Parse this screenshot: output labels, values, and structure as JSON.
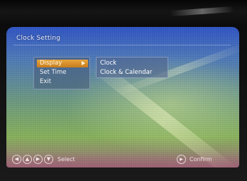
{
  "osd": {
    "title": "Clock Setting"
  },
  "menu": {
    "items": [
      {
        "label": "Display",
        "selected": true
      },
      {
        "label": "Set Time",
        "selected": false
      },
      {
        "label": "Exit",
        "selected": false
      }
    ],
    "selected_color": "#e09a35"
  },
  "submenu": {
    "items": [
      {
        "label": "Clock"
      },
      {
        "label": "Clock & Calendar"
      }
    ]
  },
  "footer": {
    "nav_icons": [
      "left-arrow-icon",
      "up-arrow-icon",
      "right-arrow-icon",
      "down-arrow-icon"
    ],
    "select_label": "Select",
    "confirm_label": "Confirm"
  }
}
